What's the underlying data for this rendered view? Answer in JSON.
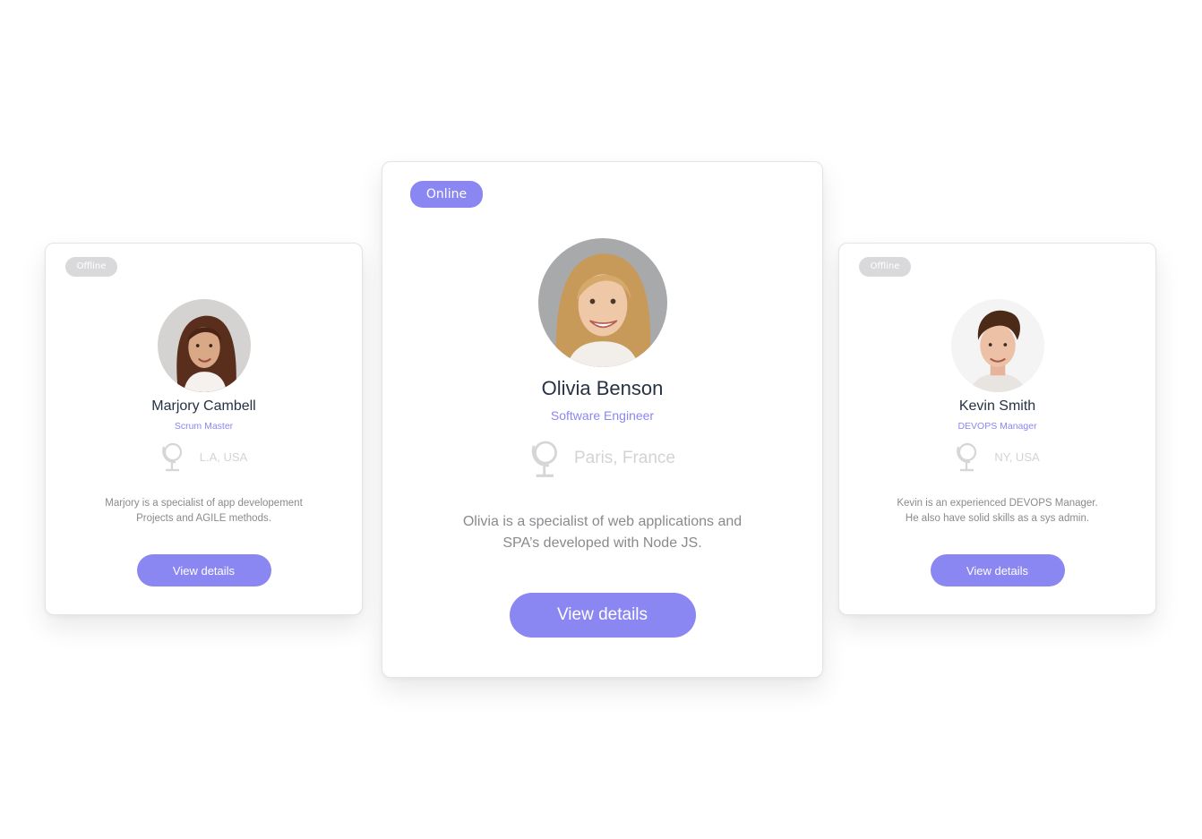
{
  "colors": {
    "accent": "#8b87f2",
    "offline_badge": "#d9d9dc",
    "name_text": "#273244",
    "location_text": "#d3d3d6",
    "description_text": "#8a8a8e"
  },
  "cards": [
    {
      "status": "Offline",
      "avatar_icon": "woman-curly-hair-avatar",
      "name": "Marjory Cambell",
      "role": "Scrum Master",
      "location_icon": "globe-icon",
      "location": "L.A, USA",
      "description_lines": [
        "Marjory is a specialist of app developement",
        "Projects and AGILE methods."
      ],
      "button_label": "View details"
    },
    {
      "status": "Online",
      "avatar_icon": "woman-blonde-avatar",
      "name": "Olivia Benson",
      "role": "Software Engineer",
      "location_icon": "globe-icon",
      "location": "Paris, France",
      "description_lines": [
        "Olivia is a specialist of web applications and",
        "SPA’s developed with Node JS."
      ],
      "button_label": "View details"
    },
    {
      "status": "Offline",
      "avatar_icon": "man-brown-hair-avatar",
      "name": "Kevin Smith",
      "role": "DEVOPS Manager",
      "location_icon": "globe-icon",
      "location": "NY, USA",
      "description_lines": [
        "Kevin is an experienced DEVOPS Manager.",
        "He also have solid skills as a sys admin."
      ],
      "button_label": "View details"
    }
  ]
}
